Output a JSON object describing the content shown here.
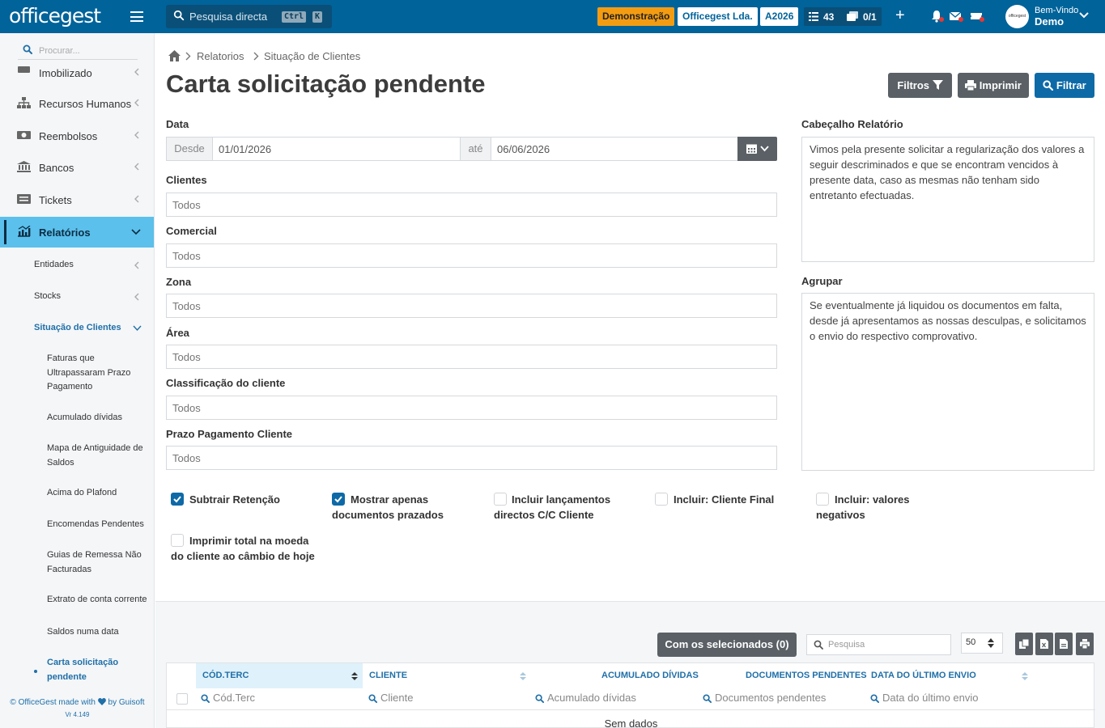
{
  "topbar": {
    "logo_text": "officegest",
    "search_placeholder": "Pesquisa directa",
    "kbd1": "Ctrl",
    "kbd2": "K",
    "pill_demo": "Demonstração",
    "pill_company": "Officegest Lda.",
    "pill_year": "A2026",
    "count_tasks": "43",
    "count_docs": "0/1",
    "plus": "+",
    "avatar_text": "officegest",
    "welcome_label": "Bem-Vindo",
    "welcome_user": "Demo"
  },
  "sidebar": {
    "search_placeholder": "Procurar...",
    "items": [
      {
        "label": "Imobilizado"
      },
      {
        "label": "Recursos Humanos"
      },
      {
        "label": "Reembolsos"
      },
      {
        "label": "Bancos"
      },
      {
        "label": "Tickets"
      },
      {
        "label": "Relatórios"
      }
    ],
    "sub_items": [
      {
        "label": "Entidades"
      },
      {
        "label": "Stocks"
      },
      {
        "label": "Situação de Clientes"
      }
    ],
    "sub_sub_items": [
      {
        "label": "Faturas que Ultrapassaram Prazo Pagamento"
      },
      {
        "label": "Acumulado dívidas"
      },
      {
        "label": "Mapa de Antiguidade de Saldos"
      },
      {
        "label": "Acima do Plafond"
      },
      {
        "label": "Encomendas Pendentes"
      },
      {
        "label": "Guias de Remessa Não Facturadas"
      },
      {
        "label": "Extrato de conta corrente"
      },
      {
        "label": "Saldos numa data"
      },
      {
        "label": "Carta solicitação pendente"
      }
    ],
    "footer_line1": "© OfficeGest made with",
    "footer_line1b": "by Guisoft",
    "footer_version": "Vr 4.149"
  },
  "breadcrumb": [
    "Relatorios",
    "Situação de Clientes"
  ],
  "page_title": "Carta solicitação pendente",
  "buttons": {
    "filtros": "Filtros",
    "imprimir": "Imprimir",
    "filtrar": "Filtrar"
  },
  "form": {
    "data_label": "Data",
    "desde_addon": "Desde",
    "desde_value": "01/01/2026",
    "ate_addon": "até",
    "ate_value": "06/06/2026",
    "clientes_label": "Clientes",
    "clientes_value": "Todos",
    "comercial_label": "Comercial",
    "comercial_value": "Todos",
    "zona_label": "Zona",
    "zona_value": "Todos",
    "area_label": "Área",
    "area_value": "Todos",
    "classificacao_label": "Classificação do cliente",
    "classificacao_value": "Todos",
    "prazo_label": "Prazo Pagamento Cliente",
    "prazo_value": "Todos",
    "cabecalho_label": "Cabeçalho Relatório",
    "cabecalho_text": "Vimos pela presente solicitar a regularização dos valores a seguir descriminados e que se encontram vencidos à presente data, caso as mesmas não tenham sido entretanto efectuadas.",
    "agrupar_label": "Agrupar",
    "agrupar_text": "Se eventualmente já liquidou os documentos em falta, desde já apresentamos as nossas desculpas, e solicitamos o envio do respectivo comprovativo."
  },
  "checkboxes": [
    {
      "label": "Subtrair Retenção",
      "checked": true
    },
    {
      "label": "Mostrar apenas documentos prazados",
      "checked": true
    },
    {
      "label": "Incluir lançamentos directos C/C Cliente",
      "checked": false
    },
    {
      "label": "Incluir: Cliente Final",
      "checked": false
    },
    {
      "label": "Incluir: valores negativos",
      "checked": false
    },
    {
      "label": "Imprimir total na moeda do cliente ao câmbio de hoje",
      "checked": false
    }
  ],
  "grid": {
    "selected_button": "Com os selecionados (0)",
    "search_placeholder": "Pesquisa",
    "page_size": "50",
    "columns": [
      "CÓD.TERC",
      "CLIENTE",
      "ACUMULADO DÍVIDAS",
      "DOCUMENTOS PENDENTES",
      "DATA DO ÚLTIMO ENVIO"
    ],
    "filters": [
      "Cód.Terc",
      "Cliente",
      "Acumulado dívidas",
      "Documentos pendentes",
      "Data do último envio"
    ],
    "no_data": "Sem dados"
  },
  "colors": {
    "topbar": "#00639a",
    "accent": "#5bc0eb",
    "primary_button": "#0e6aa7",
    "gray_button": "#5a6066",
    "demo_pill": "#f39c12"
  }
}
